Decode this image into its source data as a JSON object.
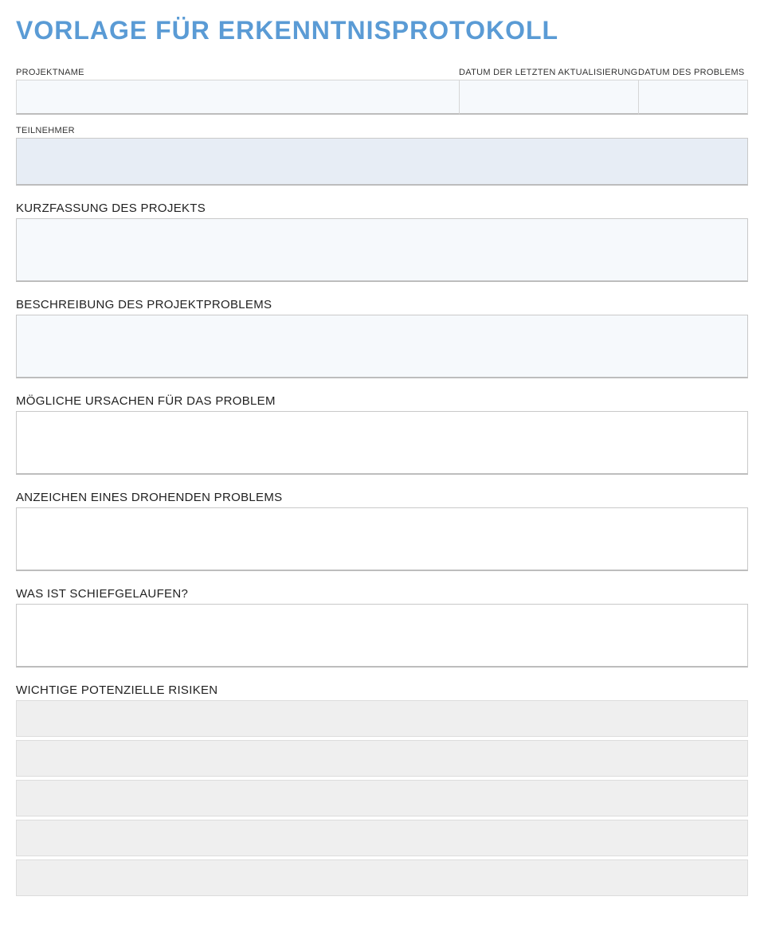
{
  "title": "VORLAGE FÜR ERKENNTNISPROTOKOLL",
  "header": {
    "projectName": {
      "label": "PROJEKTNAME",
      "value": ""
    },
    "lastUpdate": {
      "label": "DATUM DER LETZTEN AKTUALISIERUNG",
      "value": ""
    },
    "problemDate": {
      "label": "DATUM DES PROBLEMS",
      "value": ""
    }
  },
  "participants": {
    "label": "TEILNEHMER",
    "value": ""
  },
  "sections": {
    "summary": {
      "label": "KURZFASSUNG DES PROJEKTS",
      "value": ""
    },
    "problemDescription": {
      "label": "BESCHREIBUNG DES PROJEKTPROBLEMS",
      "value": ""
    },
    "possibleCauses": {
      "label": "MÖGLICHE URSACHEN FÜR DAS PROBLEM",
      "value": ""
    },
    "warningSigns": {
      "label": "ANZEICHEN EINES DROHENDEN PROBLEMS",
      "value": ""
    },
    "whatWentWrong": {
      "label": "WAS IST SCHIEFGELAUFEN?",
      "value": ""
    }
  },
  "risks": {
    "label": "WICHTIGE POTENZIELLE RISIKEN",
    "rows": [
      "",
      "",
      "",
      "",
      ""
    ]
  }
}
